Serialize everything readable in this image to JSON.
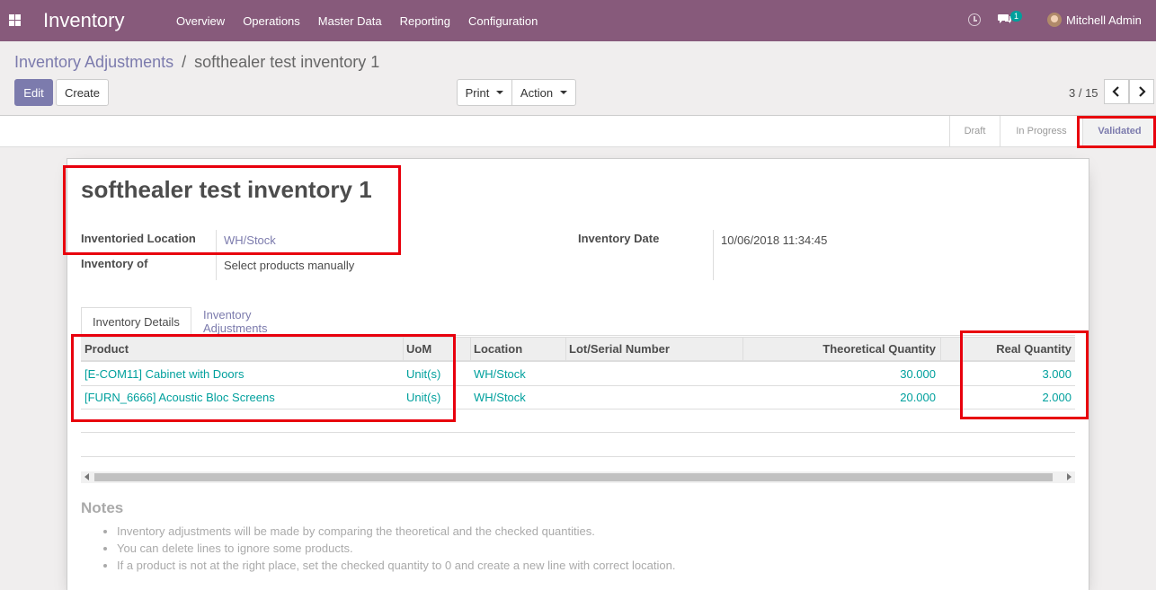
{
  "navbar": {
    "brand": "Inventory",
    "menu": [
      "Overview",
      "Operations",
      "Master Data",
      "Reporting",
      "Configuration"
    ],
    "messages_count": "1",
    "user_name": "Mitchell Admin"
  },
  "breadcrumb": {
    "parent": "Inventory Adjustments",
    "separator": "/",
    "current": "softhealer test inventory 1"
  },
  "buttons": {
    "edit": "Edit",
    "create": "Create",
    "print": "Print",
    "action": "Action"
  },
  "pager": {
    "value": "3 / 15",
    "prev": "‹",
    "next": "›"
  },
  "status": {
    "steps": [
      "Draft",
      "In Progress",
      "Validated"
    ],
    "current": "Validated"
  },
  "form": {
    "title": "softhealer test inventory 1",
    "location_label": "Inventoried Location",
    "location_value": "WH/Stock",
    "inventory_of_label": "Inventory of",
    "inventory_of_value": "Select products manually",
    "date_label": "Inventory Date",
    "date_value": "10/06/2018 11:34:45"
  },
  "tabs": [
    "Inventory Details",
    "Inventory Adjustments"
  ],
  "table": {
    "headers": [
      "Product",
      "UoM",
      "Location",
      "Lot/Serial Number",
      "Theoretical Quantity",
      "Real Quantity"
    ],
    "rows": [
      {
        "product": "[E-COM11] Cabinet with Doors",
        "uom": "Unit(s)",
        "location": "WH/Stock",
        "lot": "",
        "theoretical": "30.000",
        "real": "3.000"
      },
      {
        "product": "[FURN_6666] Acoustic Bloc Screens",
        "uom": "Unit(s)",
        "location": "WH/Stock",
        "lot": "",
        "theoretical": "20.000",
        "real": "2.000"
      }
    ]
  },
  "notes": {
    "title": "Notes",
    "items": [
      "Inventory adjustments will be made by comparing the theoretical and the checked quantities.",
      "You can delete lines to ignore some products.",
      "If a product is not at the right place, set the checked quantity to 0 and create a new line with correct location."
    ]
  },
  "colors": {
    "navbar": "#875a7b",
    "accent": "#7c7bad",
    "link": "#00a09d",
    "highlight": "#e8000d"
  }
}
